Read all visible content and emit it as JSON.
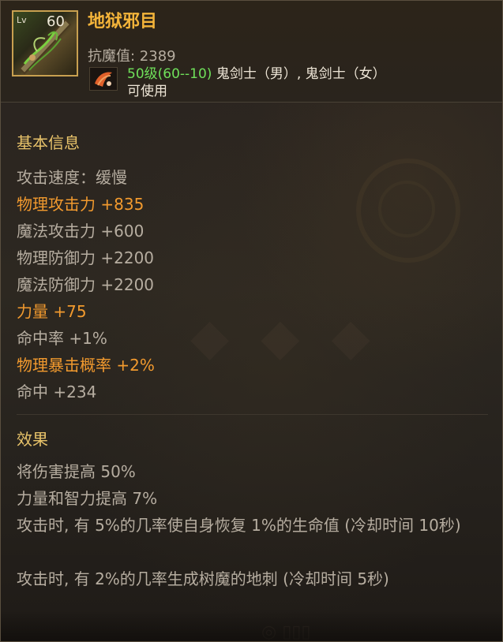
{
  "item": {
    "level_prefix": "Lv",
    "level": "60",
    "name": "地狱邪目",
    "anti_magic": "抗魔值: 2389",
    "required_level": "50级(60--10)",
    "classes": "鬼剑士（男）, 鬼剑士（女）",
    "usable": "可使用",
    "icon": "sword-item-icon",
    "class_icon": "ghost-swordsman-class-icon"
  },
  "basic": {
    "title": "基本信息",
    "stats": [
      {
        "text": "攻击速度：缓慢",
        "highlight": false
      },
      {
        "text": "物理攻击力 +835",
        "highlight": true
      },
      {
        "text": "魔法攻击力 +600",
        "highlight": false
      },
      {
        "text": "物理防御力 +2200",
        "highlight": false
      },
      {
        "text": "魔法防御力 +2200",
        "highlight": false
      },
      {
        "text": "力量 +75",
        "highlight": true
      },
      {
        "text": "命中率 +1%",
        "highlight": false
      },
      {
        "text": "物理暴击概率 +2%",
        "highlight": true
      },
      {
        "text": "命中 +234",
        "highlight": false
      }
    ]
  },
  "effects": {
    "title": "效果",
    "lines": [
      "将伤害提高 50%",
      "力量和智力提高 7%",
      "攻击时, 有 5%的几率使自身恢复 1%的生命值 (冷却时间 10秒)",
      "攻击时, 有 2%的几率生成树魔的地刺 (冷却时间 5秒)"
    ]
  },
  "colors": {
    "item_name": "#f4b43a",
    "highlight_stat": "#f29a2e",
    "normal_stat": "#b6ada0",
    "section_title": "#e8c36a",
    "required_level": "#6fe05a",
    "icon_border": "#c8a050"
  }
}
